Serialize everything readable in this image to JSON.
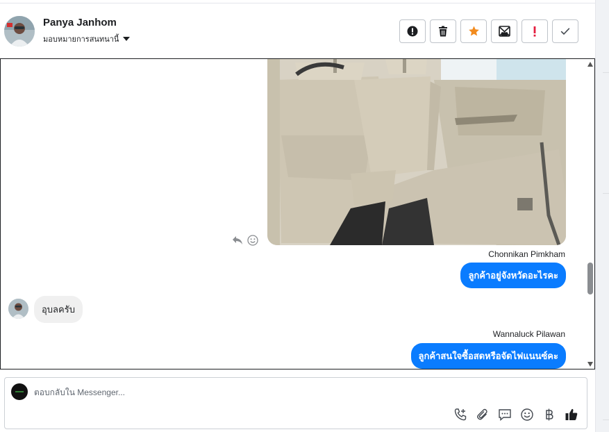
{
  "header": {
    "contact_name": "Panya Janhom",
    "assign_label": "มอบหมายการสนทนานี้",
    "actions": [
      {
        "icon": "alert-circle-icon"
      },
      {
        "icon": "trash-icon"
      },
      {
        "icon": "star-icon"
      },
      {
        "icon": "mark-unread-icon"
      },
      {
        "icon": "exclamation-icon"
      },
      {
        "icon": "check-icon"
      }
    ]
  },
  "messages": [
    {
      "type": "image",
      "direction": "out",
      "description_icon": "car-interior-photo"
    },
    {
      "sender": "Chonnikan Pimkham",
      "text": "ลูกค้าอยู่จังหวัดอะไรคะ",
      "direction": "out"
    },
    {
      "text": "อุบลครับ",
      "direction": "in"
    },
    {
      "sender": "Wannaluck Pilawan",
      "text": "ลูกค้าสนใจซื้อสดหรือจัดไฟแนนซ์คะ",
      "direction": "out"
    }
  ],
  "composer": {
    "placeholder": "ตอบกลับใน Messenger...",
    "tools": [
      "call-add-icon",
      "attachment-icon",
      "saved-reply-icon",
      "emoji-icon",
      "baht-icon",
      "thumbs-up-icon"
    ]
  },
  "colors": {
    "accent": "#0a7cff",
    "star": "#f28b1e",
    "alert_red": "#e41e3f"
  }
}
